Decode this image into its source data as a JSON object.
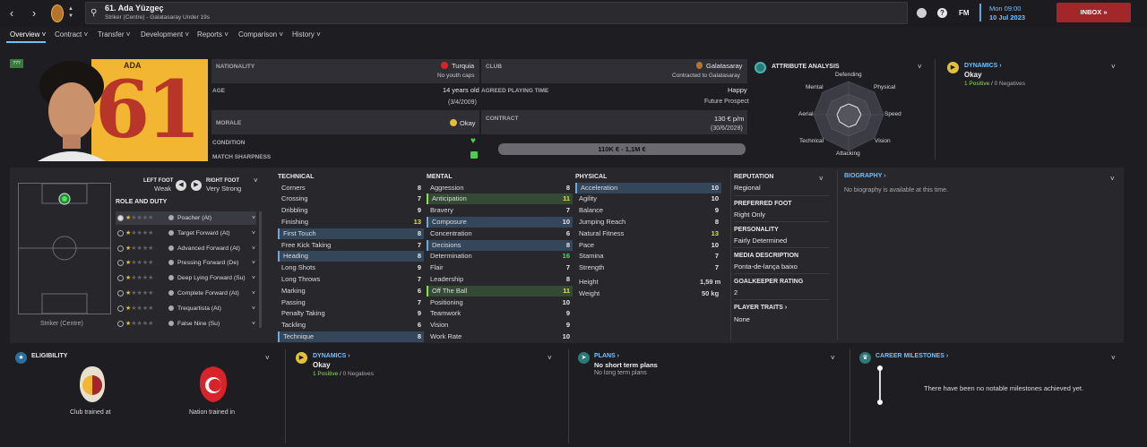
{
  "header": {
    "title": "61. Ada Yüzgeç",
    "subtitle": "Striker (Centre) - Galatasaray Under 19s",
    "date_line1": "Mon 09:00",
    "date_line2": "10 Jul 2023",
    "fm_label": "FM",
    "inbox_label": "INBOX"
  },
  "tabs": [
    "Overview",
    "Contract",
    "Transfer",
    "Development",
    "Reports",
    "Comparison",
    "History"
  ],
  "profile": {
    "shirt_name": "ADA",
    "shirt_number": "61",
    "tag": "???",
    "nationality_label": "NATIONALITY",
    "nationality": "Turquia",
    "youth_caps": "No youth caps",
    "club_label": "CLUB",
    "club": "Galatasaray",
    "club_contract": "Contracted to Galatasaray",
    "age_label": "AGE",
    "age": "14 years old",
    "dob": "(3/4/2009)",
    "playing_time_label": "AGREED PLAYING TIME",
    "playing_time": "Happy",
    "playing_time_detail": "Future Prospect",
    "morale_label": "MORALE",
    "morale": "Okay",
    "contract_label": "CONTRACT",
    "wage": "130 € p/m",
    "contract_end": "(30/6/2028)",
    "condition_label": "CONDITION",
    "match_sharpness_label": "MATCH SHARPNESS",
    "value_range": "110K € - 1,1M €"
  },
  "attribute_analysis": {
    "title": "ATTRIBUTE ANALYSIS",
    "labels": [
      "Defending",
      "Physical",
      "Speed",
      "Vision",
      "Attacking",
      "Technical",
      "Aerial",
      "Mental"
    ]
  },
  "dynamics": {
    "title": "DYNAMICS",
    "status": "Okay",
    "positives": "1 Positive",
    "separator": "/",
    "negatives": "0 Negatives"
  },
  "feet": {
    "left_label": "LEFT FOOT",
    "left_value": "Weak",
    "right_label": "RIGHT FOOT",
    "right_value": "Very Strong"
  },
  "position": "Striker (Centre)",
  "role_title": "ROLE AND DUTY",
  "roles": [
    "Poacher (At)",
    "Target Forward (At)",
    "Advanced Forward (At)",
    "Pressing Forward (De)",
    "Deep Lying Forward (Su)",
    "Complete Forward (At)",
    "Trequartista (At)",
    "False Nine (Su)"
  ],
  "technical": {
    "title": "TECHNICAL",
    "rows": [
      {
        "name": "Corners",
        "value": "8"
      },
      {
        "name": "Crossing",
        "value": "7"
      },
      {
        "name": "Dribbling",
        "value": "9"
      },
      {
        "name": "Finishing",
        "value": "13"
      },
      {
        "name": "First Touch",
        "value": "8"
      },
      {
        "name": "Free Kick Taking",
        "value": "7"
      },
      {
        "name": "Heading",
        "value": "8"
      },
      {
        "name": "Long Shots",
        "value": "9"
      },
      {
        "name": "Long Throws",
        "value": "7"
      },
      {
        "name": "Marking",
        "value": "6"
      },
      {
        "name": "Passing",
        "value": "7"
      },
      {
        "name": "Penalty Taking",
        "value": "9"
      },
      {
        "name": "Tackling",
        "value": "6"
      },
      {
        "name": "Technique",
        "value": "8"
      }
    ]
  },
  "mental": {
    "title": "MENTAL",
    "rows": [
      {
        "name": "Aggression",
        "value": "8"
      },
      {
        "name": "Anticipation",
        "value": "11"
      },
      {
        "name": "Bravery",
        "value": "7"
      },
      {
        "name": "Composure",
        "value": "10"
      },
      {
        "name": "Concentration",
        "value": "6"
      },
      {
        "name": "Decisions",
        "value": "8"
      },
      {
        "name": "Determination",
        "value": "16"
      },
      {
        "name": "Flair",
        "value": "7"
      },
      {
        "name": "Leadership",
        "value": "8"
      },
      {
        "name": "Off The Ball",
        "value": "11"
      },
      {
        "name": "Positioning",
        "value": "10"
      },
      {
        "name": "Teamwork",
        "value": "9"
      },
      {
        "name": "Vision",
        "value": "9"
      },
      {
        "name": "Work Rate",
        "value": "10"
      }
    ]
  },
  "physical": {
    "title": "PHYSICAL",
    "rows": [
      {
        "name": "Acceleration",
        "value": "10"
      },
      {
        "name": "Agility",
        "value": "10"
      },
      {
        "name": "Balance",
        "value": "9"
      },
      {
        "name": "Jumping Reach",
        "value": "8"
      },
      {
        "name": "Natural Fitness",
        "value": "13"
      },
      {
        "name": "Pace",
        "value": "10"
      },
      {
        "name": "Stamina",
        "value": "7"
      },
      {
        "name": "Strength",
        "value": "7"
      }
    ],
    "height_label": "Height",
    "height": "1,59 m",
    "weight_label": "Weight",
    "weight": "50 kg"
  },
  "info": {
    "reputation_label": "REPUTATION",
    "reputation": "Regional",
    "foot_label": "PREFERRED FOOT",
    "foot": "Right Only",
    "personality_label": "PERSONALITY",
    "personality": "Fairly Determined",
    "media_label": "MEDIA DESCRIPTION",
    "media": "Ponta-de-lança baixo",
    "gk_label": "GOALKEEPER RATING",
    "gk": "2",
    "traits_label": "PLAYER TRAITS",
    "traits": "None"
  },
  "biography": {
    "title": "BIOGRAPHY",
    "text": "No biography is available at this time."
  },
  "eligibility": {
    "title": "ELIGIBILITY",
    "club_label": "Club trained at",
    "nation_label": "Nation trained in"
  },
  "plans": {
    "title": "PLANS",
    "line1": "No short term plans",
    "line2": "No long term plans"
  },
  "milestones": {
    "title": "CAREER MILESTONES",
    "text": "There have been no notable milestones achieved yet."
  },
  "colors": {
    "accent": "#6fc0ff",
    "inbox": "#a3262a",
    "positive": "#8be04e",
    "shirt": "#f2b632"
  }
}
